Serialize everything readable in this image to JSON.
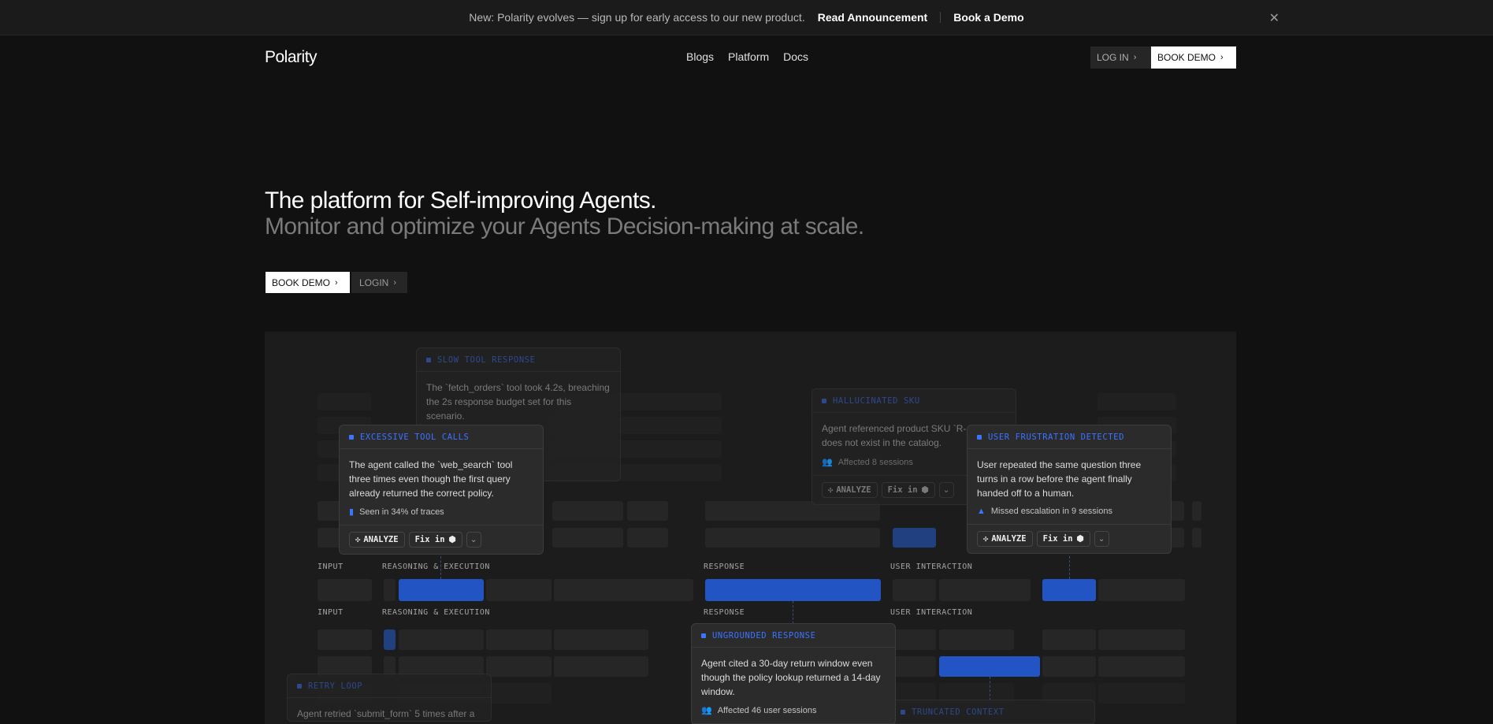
{
  "announcement": {
    "message": "New: Polarity evolves — sign up for early access to our new product.",
    "read_link": "Read Announcement",
    "demo_link": "Book a Demo",
    "close": "✕"
  },
  "header": {
    "logo": "Polarity",
    "nav": [
      "Blogs",
      "Platform",
      "Docs"
    ],
    "login": "LOG IN",
    "book_demo": "BOOK DEMO"
  },
  "hero": {
    "title": "The platform for Self-improving Agents.",
    "subtitle": "Monitor and optimize your Agents Decision-making at scale.",
    "book_demo": "BOOK DEMO",
    "login": "LOGIN"
  },
  "lanes": {
    "input": "INPUT",
    "reasoning": "REASONING & EXECUTION",
    "response": "RESPONSE",
    "user_interaction": "USER INTERACTION"
  },
  "actions": {
    "analyze": "ANALYZE",
    "fix_in": "Fix in"
  },
  "cards": {
    "slow_tool": {
      "title": "SLOW TOOL RESPONSE",
      "body": "The `fetch_orders` tool took 4.2s, breaching the 2s response budget set for this scenario."
    },
    "excessive_tools": {
      "title": "EXCESSIVE TOOL CALLS",
      "body": "The agent called the `web_search` tool three times even though the first query already returned the correct policy.",
      "meta": "Seen in 34% of traces"
    },
    "hallucinated_sku": {
      "title": "HALLUCINATED SKU",
      "body": "Agent referenced product SKU `R-… that does not exist in the catalog.",
      "meta": "Affected 8 sessions"
    },
    "user_frustration": {
      "title": "USER FRUSTRATION DETECTED",
      "body": "User repeated the same question three turns in a row before the agent finally handed off to a human.",
      "meta": "Missed escalation in 9 sessions"
    },
    "ungrounded": {
      "title": "UNGROUNDED RESPONSE",
      "body": "Agent cited a 30-day return window even though the policy lookup returned a 14-day window.",
      "meta": "Affected 46 user sessions"
    },
    "retry_loop": {
      "title": "RETRY LOOP",
      "body": "Agent retried `submit_form` 5 times after a"
    },
    "truncated_context": {
      "title": "TRUNCATED CONTEXT"
    }
  }
}
